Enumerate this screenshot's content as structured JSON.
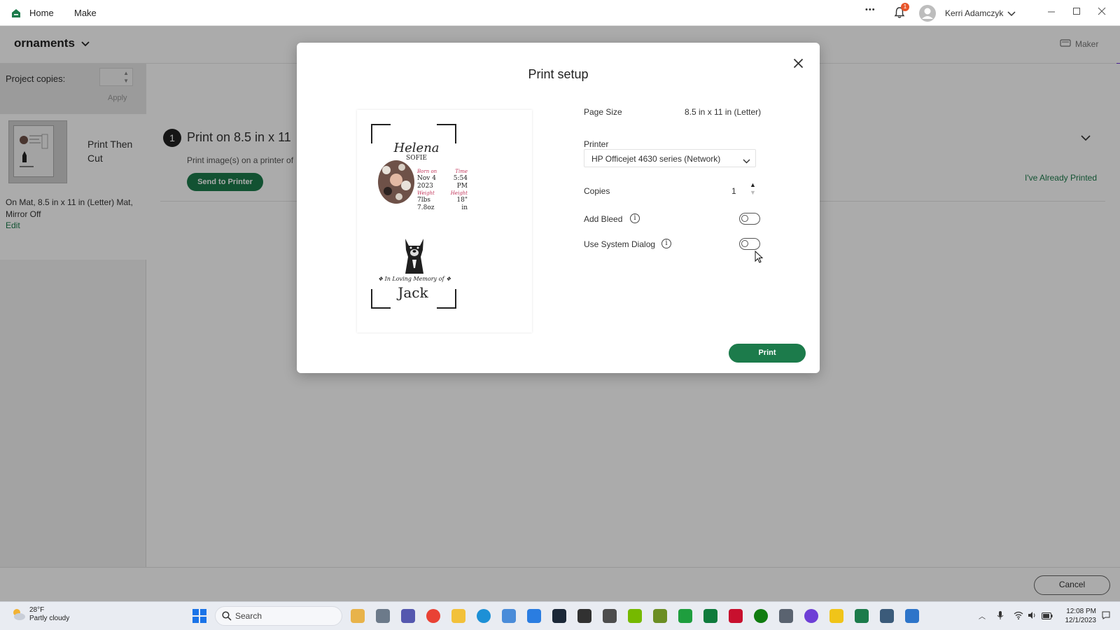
{
  "titlebar": {
    "home_label": "Home",
    "make_label": "Make",
    "more_glyph": "•••",
    "notification_count": "1",
    "user_name": "Kerri Adamczyk",
    "icons": [
      "home-icon",
      "bell-icon",
      "avatar-icon",
      "chevron-down-icon",
      "minimize-icon",
      "maximize-icon",
      "close-icon"
    ]
  },
  "header": {
    "project_name": "ornaments",
    "machine_label": "Maker"
  },
  "left_panel": {
    "copies_label": "Project copies:",
    "apply_label": "Apply",
    "mat_title": "Print Then Cut",
    "mat_details": "On Mat, 8.5 in x 11 in (Letter) Mat, Mirror Off",
    "edit_label": "Edit"
  },
  "main": {
    "step_number": "1",
    "step_title": "Print on 8.5 in x 11",
    "step_desc": "Print image(s) on a printer of",
    "send_button": "Send to Printer",
    "already_printed": "I've Already Printed"
  },
  "footer": {
    "cancel_label": "Cancel"
  },
  "modal": {
    "title": "Print setup",
    "page_size_label": "Page Size",
    "page_size_value": "8.5 in x 11 in (Letter)",
    "printer_label": "Printer",
    "printer_value": "HP Officejet 4630 series (Network)",
    "copies_label": "Copies",
    "copies_value": "1",
    "add_bleed_label": "Add Bleed",
    "add_bleed_on": false,
    "system_dialog_label": "Use System Dialog",
    "system_dialog_on": false,
    "print_button": "Print",
    "preview": {
      "name1": "Helena",
      "name2": "SOFIE",
      "born_on_label": "Born on",
      "born_date": "Nov 4",
      "born_year": "2023",
      "time_label": "Time",
      "time_value": "5:54",
      "time_ampm": "PM",
      "weight_label": "Weight",
      "weight_value": "7lbs",
      "height_label": "Height",
      "height_value": "18\"",
      "oz_value": "7.8oz",
      "in_value": "in",
      "memory_text": "In Loving Memory of",
      "pet_name": "Jack"
    }
  },
  "taskbar": {
    "weather_temp": "28°F",
    "weather_desc": "Partly cloudy",
    "search_label": "Search",
    "time": "12:08 PM",
    "date": "12/1/2023"
  },
  "colors": {
    "brand_green": "#1c7b4b",
    "overlay": "rgba(0,0,0,0.33)",
    "notification": "#e8552a",
    "accent_purple": "#6b2fd8"
  }
}
